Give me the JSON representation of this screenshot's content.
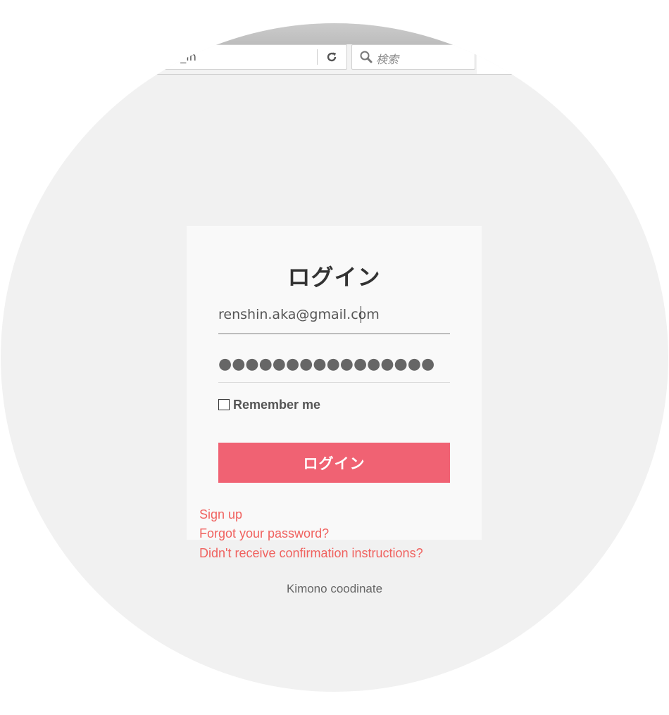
{
  "browser": {
    "url_fragment": "gn_in",
    "search_placeholder": "検索",
    "more_glyph": "▸"
  },
  "login": {
    "title": "ログイン",
    "email_value": "renshin.aka@gmail.com",
    "password_masked": "●●●●●●●●●●●●●●●●",
    "remember_label": "Remember me",
    "remember_checked": false,
    "submit_label": "ログイン"
  },
  "links": {
    "sign_up": "Sign up",
    "forgot_password": "Forgot your password?",
    "confirmation": "Didn't receive confirmation instructions?"
  },
  "footer": {
    "brand": "Kimono coodinate"
  },
  "colors": {
    "accent": "#f06273",
    "link": "#f0625f",
    "background": "#f1f1f1",
    "card": "#f9f9f9"
  }
}
